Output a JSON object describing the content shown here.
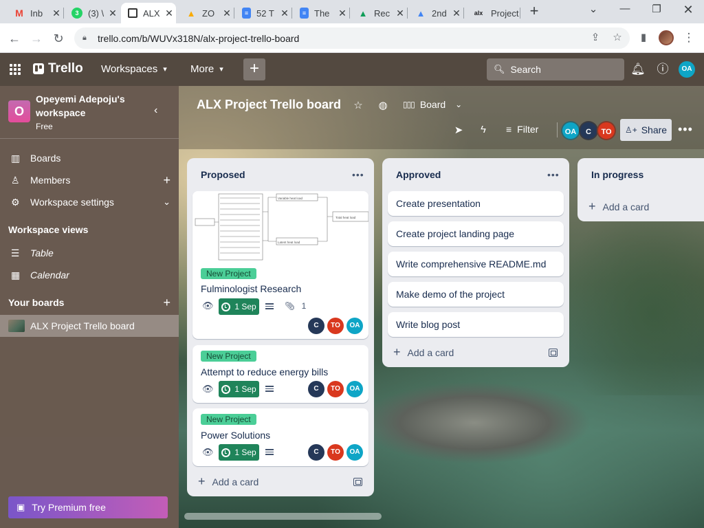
{
  "browser": {
    "tabs": [
      {
        "title": "Inb",
        "icon": "gmail-icon",
        "active": false
      },
      {
        "title": "(3) \\",
        "icon": "whatsapp-icon",
        "active": false
      },
      {
        "title": "ALX",
        "icon": "trello-icon",
        "active": true
      },
      {
        "title": "ZO",
        "icon": "google-drive-icon",
        "active": false
      },
      {
        "title": "52 T",
        "icon": "google-docs-icon",
        "active": false
      },
      {
        "title": "The",
        "icon": "google-docs-icon",
        "active": false
      },
      {
        "title": "Rec",
        "icon": "google-drive-icon",
        "active": false
      },
      {
        "title": "2nd",
        "icon": "google-drive-icon",
        "active": false
      },
      {
        "title": "Project",
        "icon": "alx-icon",
        "active": false
      }
    ],
    "url": "trello.com/b/WUVx318N/alx-project-trello-board"
  },
  "header": {
    "logo": "Trello",
    "workspaces": "Workspaces",
    "more": "More",
    "search_placeholder": "Search",
    "user_initials": "OA"
  },
  "sidebar": {
    "workspace_initial": "O",
    "workspace_name": "Opeyemi Adepoju's workspace",
    "plan": "Free",
    "items": [
      {
        "label": "Boards",
        "icon": "boards-icon"
      },
      {
        "label": "Members",
        "icon": "person-icon"
      },
      {
        "label": "Workspace settings",
        "icon": "gear-icon"
      }
    ],
    "views_heading": "Workspace views",
    "views": [
      {
        "label": "Table",
        "icon": "table-icon"
      },
      {
        "label": "Calendar",
        "icon": "calendar-icon"
      }
    ],
    "boards_heading": "Your boards",
    "boards": [
      {
        "label": "ALX Project Trello board"
      }
    ],
    "premium": "Try Premium free"
  },
  "board": {
    "title": "ALX Project Trello board",
    "view": "Board",
    "filter": "Filter",
    "share": "Share",
    "members": [
      {
        "initials": "OA",
        "color": "#0ea5c6"
      },
      {
        "initials": "C",
        "color": "#253858"
      },
      {
        "initials": "TO",
        "color": "#d9381e"
      }
    ],
    "lists": [
      {
        "title": "Proposed",
        "cards": [
          {
            "label": "New Project",
            "title": "Fulminologist Research",
            "due": "1 Sep",
            "attachments": "1",
            "cover_labels": [
              "Variable heat load",
              "Total heat load",
              "Latent heat load"
            ]
          },
          {
            "label": "New Project",
            "title": "Attempt to reduce energy bills",
            "due": "1 Sep"
          },
          {
            "label": "New Project",
            "title": "Power Solutions",
            "due": "1 Sep"
          }
        ],
        "add_card": "Add a card"
      },
      {
        "title": "Approved",
        "cards": [
          {
            "title": "Create presentation"
          },
          {
            "title": "Create project landing page"
          },
          {
            "title": "Write comprehensive README.md"
          },
          {
            "title": "Make demo of the project"
          },
          {
            "title": "Write blog post"
          }
        ],
        "add_card": "Add a card"
      },
      {
        "title": "In progress",
        "cards": [],
        "add_card": "Add a card"
      }
    ],
    "card_members": [
      {
        "initials": "C",
        "color": "#253858"
      },
      {
        "initials": "TO",
        "color": "#d9381e"
      },
      {
        "initials": "OA",
        "color": "#0ea5c6"
      }
    ]
  }
}
